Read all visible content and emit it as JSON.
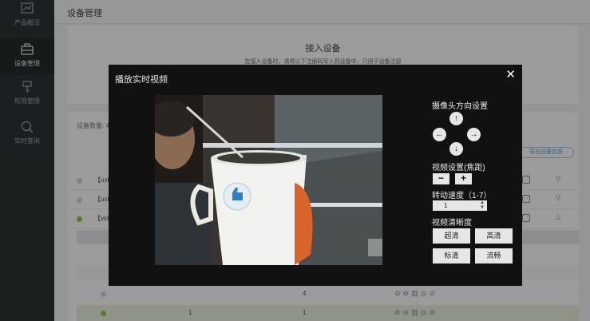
{
  "sidebar": {
    "items": [
      {
        "label": "产品概况",
        "icon": "chart-icon"
      },
      {
        "label": "设备管理",
        "icon": "device-icon",
        "active": true
      },
      {
        "label": "权限管理",
        "icon": "key-icon"
      },
      {
        "label": "实时查询",
        "icon": "magnifier-icon"
      }
    ]
  },
  "header": {
    "title": "设备管理"
  },
  "panel": {
    "title": "接入设备",
    "desc": "在接入设备时，请将以下注册码写入到设备中，只用于设备注册"
  },
  "list": {
    "count": "设备数量: 4",
    "export_label": "导出设备信息",
    "rows": [
      {
        "name": "【usb",
        "expand": "▽"
      },
      {
        "name": "【usb (",
        "expand": "▽"
      },
      {
        "name": "【vide",
        "expand": "△"
      }
    ],
    "subrows": [
      {
        "c1": "",
        "c2": "4"
      },
      {
        "c1": "1",
        "c2": "1"
      }
    ]
  },
  "modal": {
    "title": "播放实时视频",
    "close": "✕",
    "camera_direction_label": "摄像头方向设置",
    "focus_label": "视频设置(焦距)",
    "zoom_out": "−",
    "zoom_in": "+",
    "speed_label": "转动速度（1-7）",
    "speed_value": "1",
    "clarity_label": "视频清晰度",
    "clarity_options": [
      "超清",
      "高清",
      "标清",
      "流畅"
    ]
  },
  "colors": {
    "online": "#8cc63f",
    "sidebar": "#2b3237",
    "modal_bg": "#111111"
  }
}
